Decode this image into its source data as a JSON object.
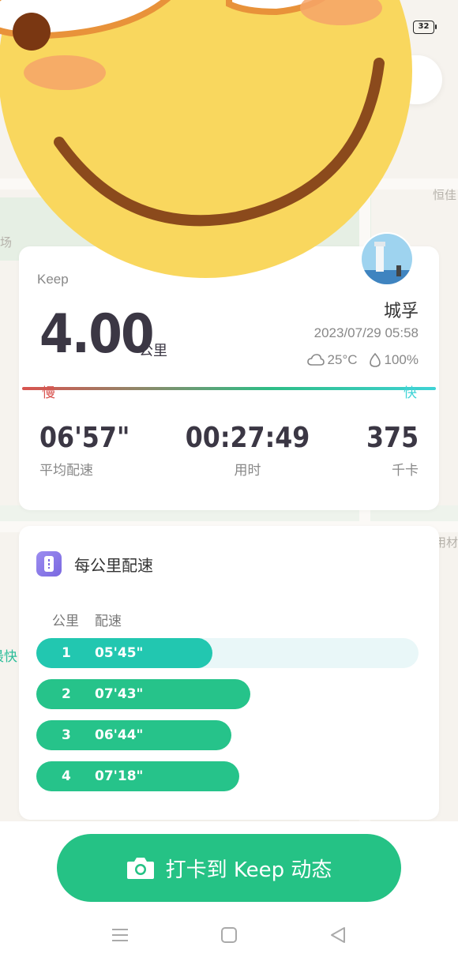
{
  "status": {
    "battery": "32"
  },
  "map": {
    "labels": [
      "恒佳",
      "场",
      "用材"
    ]
  },
  "summary": {
    "brand": "Keep",
    "distance": "4.00",
    "distance_unit": "公里",
    "username": "城孚",
    "datetime": "2023/07/29 05:58",
    "temperature": "25°C",
    "humidity": "100%",
    "slow_label": "慢",
    "fast_label": "快",
    "stats": [
      {
        "value": "06'57\"",
        "label": "平均配速"
      },
      {
        "value": "00:27:49",
        "label": "用时"
      },
      {
        "value": "375",
        "label": "千卡"
      }
    ]
  },
  "pace": {
    "title": "每公里配速",
    "col_km": "公里",
    "col_pace": "配速",
    "best_label": "最快",
    "rows": [
      {
        "km": "1",
        "pace": "05'45\"",
        "fill": 0.46,
        "color": "#22c7b0",
        "best": true
      },
      {
        "km": "2",
        "pace": "07'43\"",
        "fill": 0.56,
        "color": "#26c38a",
        "best": false
      },
      {
        "km": "3",
        "pace": "06'44\"",
        "fill": 0.51,
        "color": "#26c38a",
        "best": false
      },
      {
        "km": "4",
        "pace": "07'18\"",
        "fill": 0.53,
        "color": "#26c38a",
        "best": false
      }
    ]
  },
  "share_button": {
    "label": "打卡到 Keep 动态",
    "icon": "camera-icon"
  },
  "nav": {
    "icons": [
      "menu-icon",
      "home-icon",
      "back-icon"
    ]
  }
}
